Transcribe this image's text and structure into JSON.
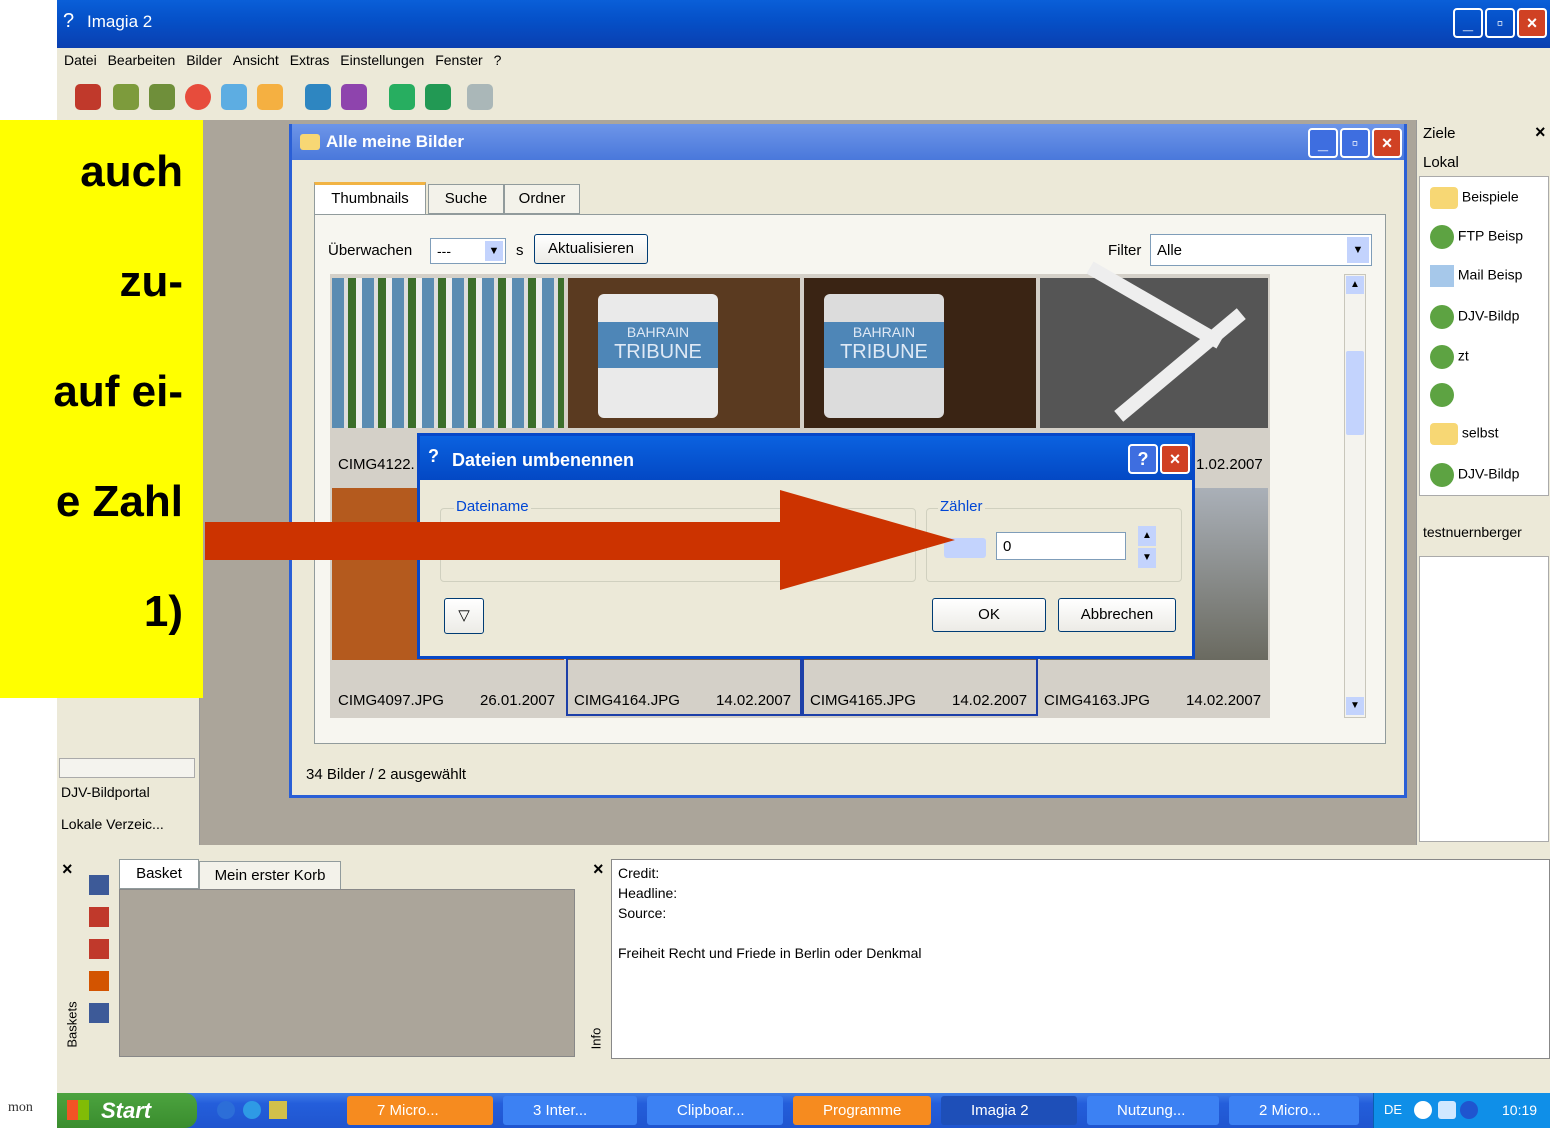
{
  "app": {
    "title": "Imagia 2"
  },
  "menu": [
    "Datei",
    "Bearbeiten",
    "Bilder",
    "Ansicht",
    "Extras",
    "Einstellungen",
    "Fenster",
    "?"
  ],
  "callout": {
    "lines": [
      "auch",
      "zu-",
      "auf ei-",
      "e Zahl",
      "1)"
    ]
  },
  "left_pane": {
    "items": [
      "DJV-Bildportal",
      "Lokale Verzeic..."
    ]
  },
  "album": {
    "title": "Alle meine Bilder",
    "tabs": [
      "Thumbnails",
      "Suche",
      "Ordner"
    ],
    "watch_label": "Überwachen",
    "watch_value": "---",
    "watch_unit": "s",
    "refresh_button": "Aktualisieren",
    "filter_label": "Filter",
    "filter_value": "Alle",
    "row1_captions": [
      "CIMG4122.",
      "1.02.2007"
    ],
    "row2": [
      {
        "name": "CIMG4097.JPG",
        "date": "26.01.2007"
      },
      {
        "name": "CIMG4164.JPG",
        "date": "14.02.2007"
      },
      {
        "name": "CIMG4165.JPG",
        "date": "14.02.2007"
      },
      {
        "name": "CIMG4163.JPG",
        "date": "14.02.2007"
      }
    ],
    "thumb_mug_text": [
      "BAHRAIN",
      "TRIBUNE"
    ],
    "status": "34 Bilder / 2 ausgewählt"
  },
  "dialog": {
    "title": "Dateien umbenennen",
    "help_button": "?",
    "filename_label": "Dateiname",
    "counter_label": "Zähler",
    "counter_value": "0",
    "ok_button": "OK",
    "cancel_button": "Abbrechen"
  },
  "targets": {
    "title": "Ziele",
    "close": "×",
    "section": "Lokal",
    "items": [
      "Beispiele",
      "FTP Beisp",
      "Mail Beisp",
      "DJV-Bildp",
      "zt",
      "",
      "selbst",
      "DJV-Bildp"
    ],
    "user": "testnuernberger"
  },
  "baskets": {
    "side_label": "Baskets",
    "tabs": [
      "Basket",
      "Mein erster Korb"
    ]
  },
  "info": {
    "side_label": "Info",
    "lines": [
      "Credit:",
      "Headline:",
      "Source:",
      "",
      "Freiheit Recht und Friede in Berlin oder Denkmal"
    ]
  },
  "taskbar": {
    "start": "Start",
    "items": [
      "7 Micro...",
      "3 Inter...",
      "Clipboar...",
      "Programme",
      "Imagia 2",
      "Nutzung...",
      "2 Micro..."
    ],
    "lang": "DE",
    "clock": "10:19",
    "left_edge_text": "mon"
  },
  "colors": {
    "arrow": "#cc3300",
    "callout": "#ffff00",
    "xp_blue": "#0a5fd8"
  }
}
